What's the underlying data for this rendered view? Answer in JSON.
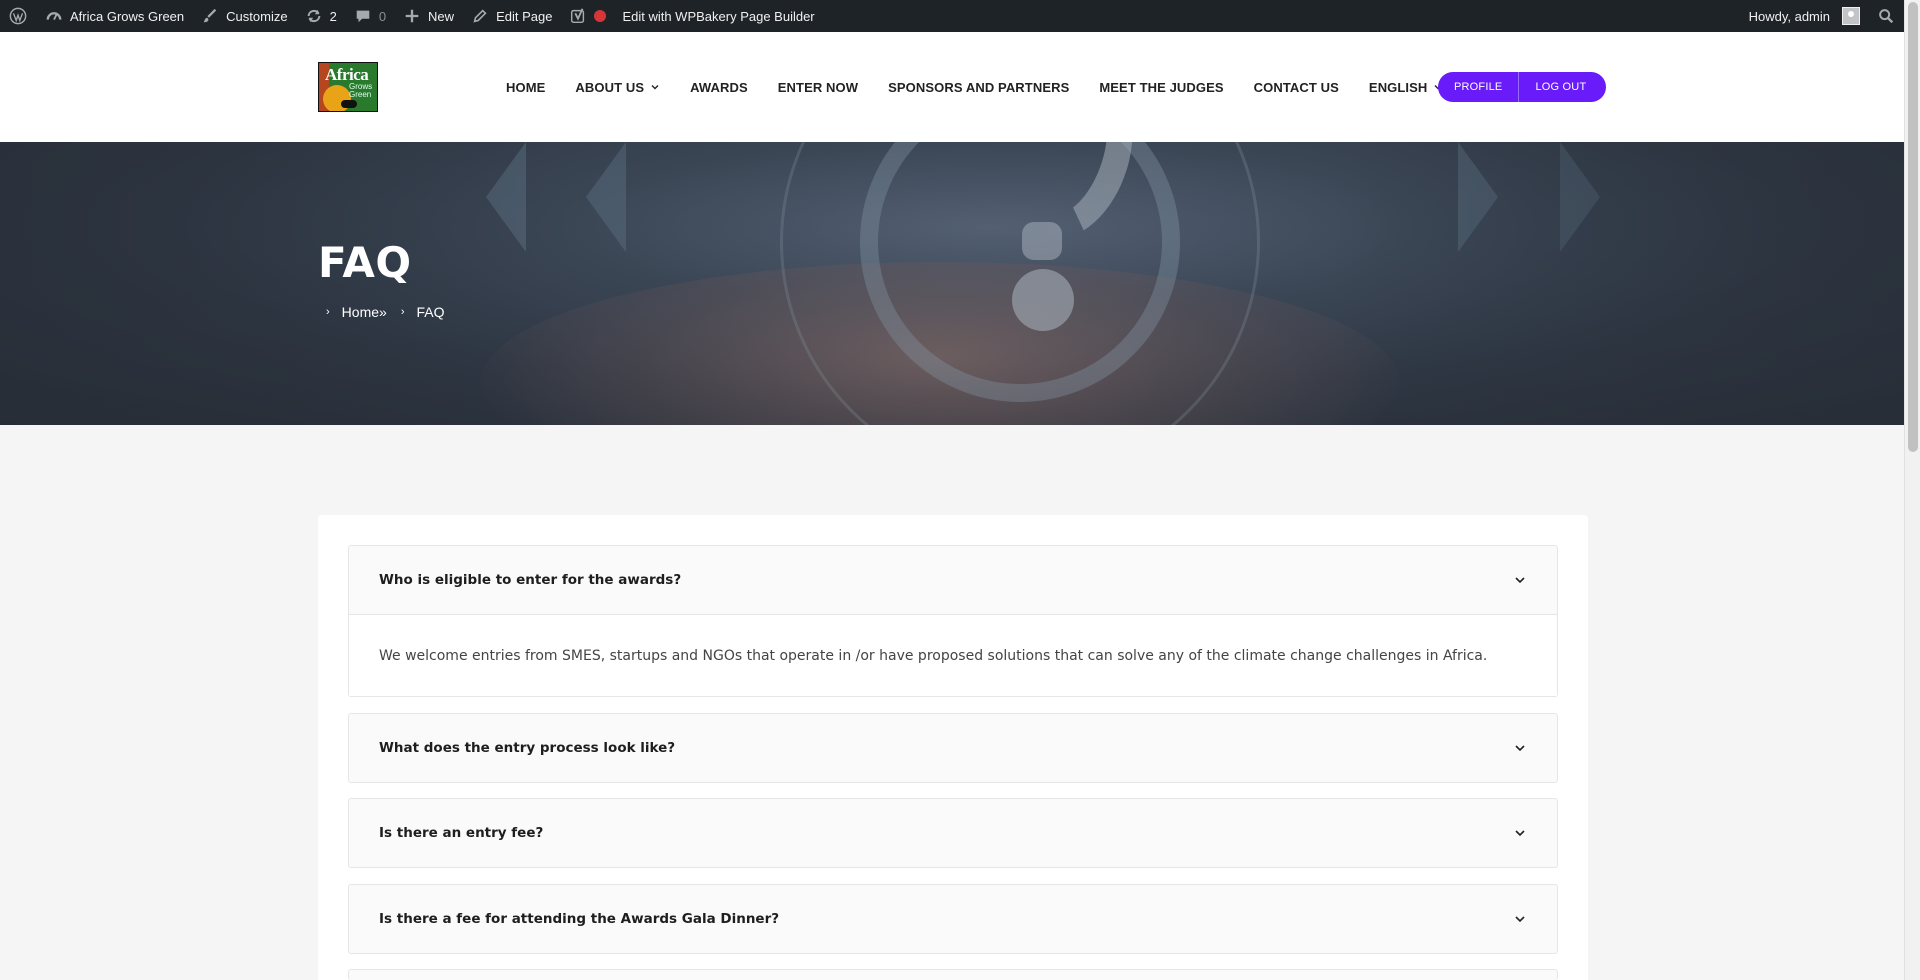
{
  "adminbar": {
    "site_name": "Africa Grows Green",
    "customize": "Customize",
    "updates_count": "2",
    "comments_count": "0",
    "new": "New",
    "edit_page": "Edit Page",
    "wpbakery": "Edit with WPBakery Page Builder",
    "howdy": "Howdy, admin"
  },
  "logo": {
    "line1": "Africa",
    "line2": "Grows",
    "line3": "Green"
  },
  "nav": {
    "items": [
      {
        "label": "HOME"
      },
      {
        "label": "ABOUT US"
      },
      {
        "label": "AWARDS"
      },
      {
        "label": "ENTER NOW"
      },
      {
        "label": "SPONSORS AND PARTNERS"
      },
      {
        "label": "MEET THE JUDGES"
      },
      {
        "label": "CONTACT US"
      },
      {
        "label": "ENGLISH"
      }
    ]
  },
  "auth": {
    "profile": "PROFILE",
    "logout": "LOG OUT"
  },
  "hero": {
    "title": "FAQ",
    "breadcrumb_home": "Home»",
    "breadcrumb_current": "FAQ"
  },
  "faq": [
    {
      "question": "Who is eligible to enter for the awards?",
      "answer": "We welcome entries from SMES, startups and NGOs that operate in /or have proposed solutions that can solve any of the climate change challenges in Africa."
    },
    {
      "question": "What does the entry process look like?"
    },
    {
      "question": "Is there an entry fee?"
    },
    {
      "question": "Is there a fee for attending the Awards Gala Dinner?"
    }
  ]
}
